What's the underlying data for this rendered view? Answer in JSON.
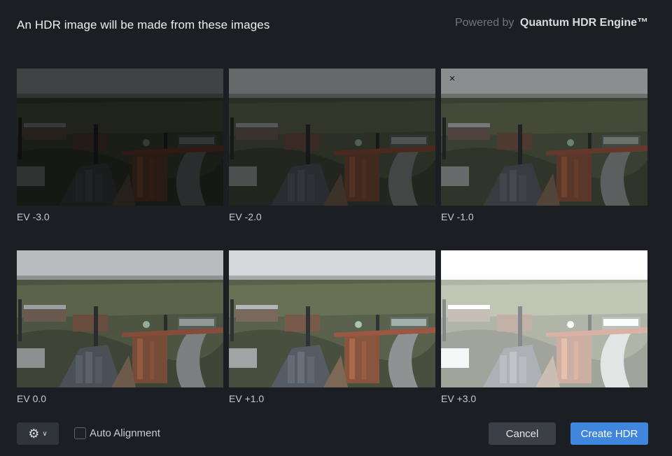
{
  "dialog": {
    "title": "An HDR image will be made from these images",
    "powered_prefix": "Powered by",
    "powered_brand": "Quantum HDR Engine™"
  },
  "images": [
    {
      "label": "EV -3.0",
      "brightness": 0.35
    },
    {
      "label": "EV -2.0",
      "brightness": 0.55
    },
    {
      "label": "EV -1.0",
      "brightness": 0.75
    },
    {
      "label": "EV 0.0",
      "brightness": 1.0
    },
    {
      "label": "EV +1.0",
      "brightness": 1.15
    },
    {
      "label": "EV +3.0",
      "brightness": 1.7
    }
  ],
  "remove_icon": "×",
  "footer": {
    "settings_icon": "⚙",
    "chevron_icon": "∨",
    "auto_alignment_label": "Auto Alignment",
    "auto_alignment_checked": false,
    "cancel_label": "Cancel",
    "create_label": "Create HDR"
  },
  "colors": {
    "background": "#1b1f24",
    "primary_button": "#3f86dc",
    "secondary_button": "#3a4046"
  }
}
